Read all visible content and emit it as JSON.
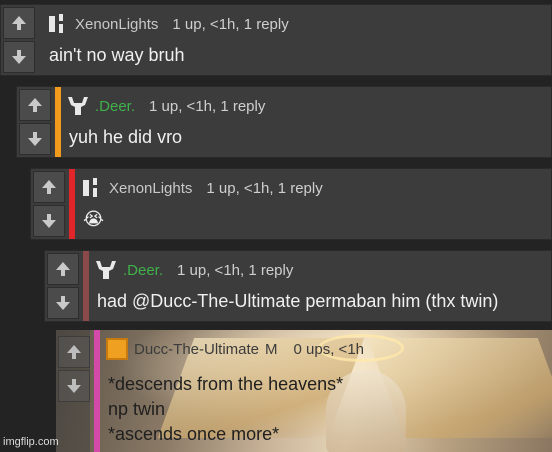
{
  "comments": [
    {
      "username": "XenonLights",
      "stats": "1 up, <1h, 1 reply",
      "text": "ain't no way bruh"
    },
    {
      "username": ".Deer.",
      "stats": "1 up, <1h, 1 reply",
      "text": "yuh he did vro"
    },
    {
      "username": "XenonLights",
      "stats": "1 up, <1h, 1 reply",
      "text": "😭"
    },
    {
      "username": ".Deer.",
      "stats": "1 up, <1h, 1 reply",
      "text": "had @Ducc-The-Ultimate permaban him (thx twin)"
    },
    {
      "username": "Ducc-The-Ultimate",
      "mod_badge": "M",
      "stats": "0 ups, <1h",
      "lines": [
        "*descends from the heavens*",
        "np twin",
        "*ascends once more*"
      ]
    }
  ],
  "accent_colors": [
    "#f29a1c",
    "#e0252b",
    "#8a4a4a",
    "#d44aa8"
  ],
  "watermark": "imgflip.com"
}
